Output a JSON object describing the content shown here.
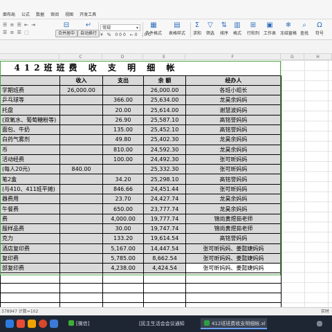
{
  "menu_tabs": [
    "面布局",
    "公式",
    "数据",
    "审阅",
    "视图",
    "开发工具"
  ],
  "ribbon": {
    "merge_label": "合并居中",
    "wrap_label": "自动换行",
    "format_value": "常规",
    "num_icons": "¥ % 000 ←0 .00",
    "cond_format": "条件格式",
    "table_style": "表格样式",
    "sum": "求和",
    "filter": "筛选",
    "sort": "排序",
    "format": "格式",
    "row_col": "行和列",
    "worksheet": "工作表",
    "freeze": "冻结窗格",
    "find": "查找",
    "symbol": "符号"
  },
  "columns": [
    "C",
    "D",
    "E",
    "F",
    "G",
    "H"
  ],
  "sheet": {
    "title": "412班班费  收  支  明  细  帐",
    "headers": {
      "income": "收入",
      "expense": "支出",
      "balance": "余  额",
      "handler": "经办人"
    },
    "rows": [
      {
        "item": "学期班费",
        "income": "26,000.00",
        "expense": "",
        "balance": "26,000.00",
        "handler": "各班小组长"
      },
      {
        "item": "乒乓球等",
        "income": "",
        "expense": "366.00",
        "balance": "25,634.00",
        "handler": "龙昊余妈妈"
      },
      {
        "item": "托盘",
        "income": "",
        "expense": "20.00",
        "balance": "25,614.00",
        "handler": "谢慧波妈妈"
      },
      {
        "item": "(双氧水、葡萄糖粉等)",
        "income": "",
        "expense": "26.90",
        "balance": "25,587.10",
        "handler": "高铭誉妈妈"
      },
      {
        "item": "面包、牛奶",
        "income": "",
        "expense": "135.00",
        "balance": "25,452.10",
        "handler": "高铭誉妈妈"
      },
      {
        "item": "白药气雾剂",
        "income": "",
        "expense": "49.80",
        "balance": "25,402.30",
        "handler": "龙昊余妈妈"
      },
      {
        "item": "币",
        "income": "",
        "expense": "810.00",
        "balance": "24,592.30",
        "handler": "龙昊余妈妈"
      },
      {
        "item": "活动经费",
        "income": "",
        "expense": "100.00",
        "balance": "24,492.30",
        "handler": "张可昕妈妈"
      },
      {
        "item": "(每人20元)",
        "income": "840.00",
        "expense": "",
        "balance": "25,332.30",
        "handler": "张可昕妈妈"
      },
      {
        "item": "笔2盒",
        "income": "",
        "expense": "34.20",
        "balance": "25,298.10",
        "handler": "高铭誉妈妈"
      },
      {
        "item": "(与410、411班平摊)",
        "income": "",
        "expense": "846.66",
        "balance": "24,451.44",
        "handler": "张可昕妈妈"
      },
      {
        "item": "器费用",
        "income": "",
        "expense": "23.70",
        "balance": "24,427.74",
        "handler": "龙昊余妈妈"
      },
      {
        "item": "午餐费",
        "income": "",
        "expense": "650.00",
        "balance": "23,777.74",
        "handler": "龙昊余妈妈"
      },
      {
        "item": "费",
        "income": "",
        "expense": "4,000.00",
        "balance": "19,777.74",
        "handler": "锦尚黄煜茹老师"
      },
      {
        "item": "服样品费",
        "income": "",
        "expense": "30.00",
        "balance": "19,747.74",
        "handler": "锦尚黄煜茹老师"
      },
      {
        "item": "克力",
        "income": "",
        "expense": "133.20",
        "balance": "19,614.54",
        "handler": "高铭誉妈妈"
      },
      {
        "item": "酒店复印费",
        "income": "",
        "expense": "5,167.00",
        "balance": "14,447.54",
        "handler": "张可昕妈妈、姜懿婕妈妈"
      },
      {
        "item": "复印费",
        "income": "",
        "expense": "5,785.00",
        "balance": "8,662.54",
        "handler": "张可昕妈妈、姜懿婕妈妈"
      },
      {
        "item": "部复印费",
        "income": "",
        "expense": "4,238.00",
        "balance": "4,424.54",
        "handler": "张可昕妈妈、姜懿婕妈妈"
      }
    ]
  },
  "status_bar": {
    "left": "378947 计数=102",
    "right": "实时"
  },
  "taskbar": {
    "wechat": "[微信]",
    "doc": "[民主生活会会议通知",
    "excel": "412班班费收支明细帐.xl"
  }
}
